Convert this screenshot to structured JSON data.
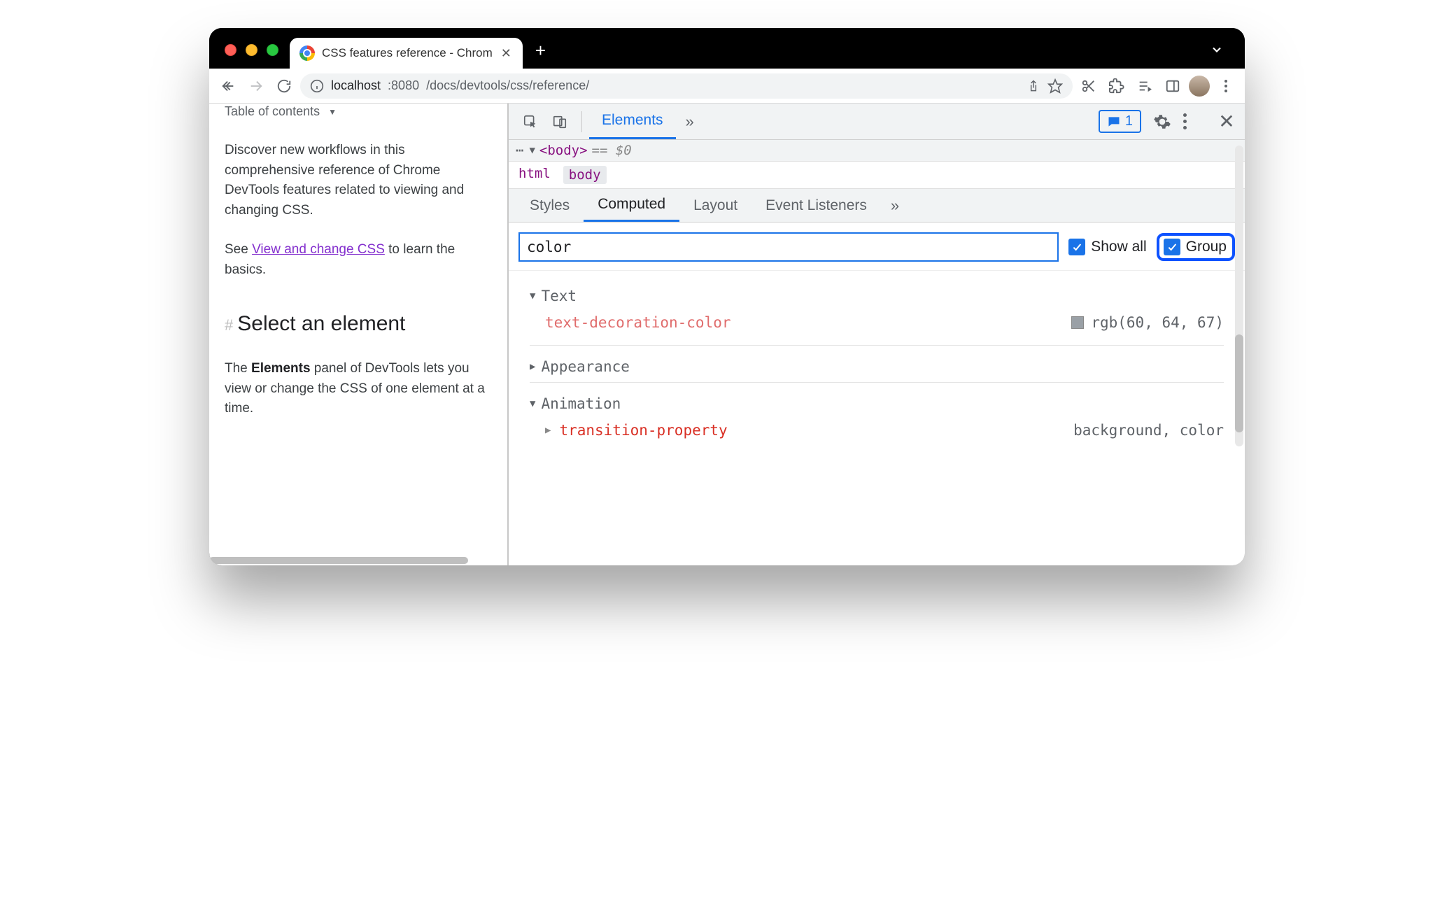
{
  "tab": {
    "title": "CSS features reference - Chrom"
  },
  "addr": {
    "host": "localhost",
    "port": ":8080",
    "path": "/docs/devtools/css/reference/"
  },
  "page": {
    "toc": "Table of contents",
    "para1": "Discover new workflows in this comprehensive reference of Chrome DevTools features related to viewing and changing CSS.",
    "para2a": "See ",
    "link": "View and change CSS",
    "para2b": " to learn the basics.",
    "heading": "Select an element",
    "para3a": "The ",
    "strong": "Elements",
    "para3b": " panel of DevTools lets you view or change the CSS of one element at a time."
  },
  "devtools": {
    "maintab": "Elements",
    "badge": "1",
    "dom": {
      "tag": "<body>",
      "sel": "== $0"
    },
    "breadcrumb": [
      "html",
      "body"
    ],
    "paneltabs": [
      "Styles",
      "Computed",
      "Layout",
      "Event Listeners"
    ],
    "filter": "color",
    "showall": "Show all",
    "group": "Group",
    "groups": {
      "text": {
        "label": "Text",
        "prop": "text-decoration-color",
        "val": "rgb(60, 64, 67)"
      },
      "appearance": {
        "label": "Appearance"
      },
      "animation": {
        "label": "Animation",
        "prop": "transition-property",
        "val": "background, color"
      }
    }
  }
}
